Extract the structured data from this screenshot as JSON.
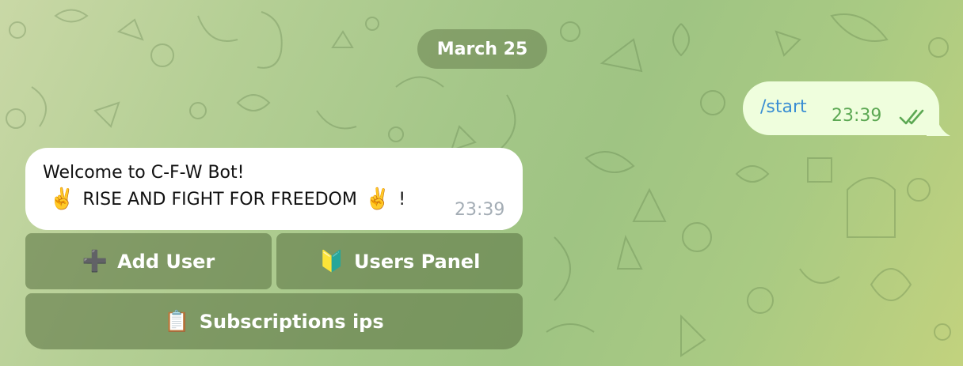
{
  "date_separator": "March 25",
  "outgoing_message": {
    "text": "/start",
    "time": "23:39",
    "status_icon": "double-check-icon"
  },
  "incoming_message": {
    "line1": "Welcome to C-F-W Bot!",
    "line2_emoji_left": "✌️",
    "line2_text": "RISE AND FIGHT FOR FREEDOM",
    "line2_emoji_right": "✌️",
    "line2_suffix": "!",
    "time": "23:39"
  },
  "inline_keyboard": {
    "add_user": {
      "icon": "➕",
      "label": "Add User"
    },
    "users_panel": {
      "icon": "🔰",
      "label": "Users Panel"
    },
    "subscriptions": {
      "icon": "📋",
      "label": "Subscriptions ips"
    }
  },
  "colors": {
    "outgoing_bubble": "#effedd",
    "outgoing_text": "#3a8ed3",
    "outgoing_time": "#5ca853",
    "incoming_bubble": "#ffffff",
    "button_fill": "rgba(92,116,68,0.58)"
  }
}
